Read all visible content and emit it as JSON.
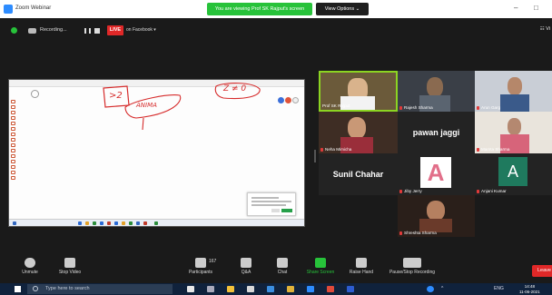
{
  "window": {
    "title": "Zoom Webinar",
    "viewing_banner": "You are viewing Prof SK Rajput's screen",
    "view_options": "View Options ⌄",
    "controls": [
      "–",
      "□"
    ]
  },
  "status": {
    "recording_label": "Recording...",
    "live_badge": "LIVE",
    "live_on": "on Facebook ▾",
    "view_button": "☷ Vi"
  },
  "share": {
    "annotation_1": ">2",
    "annotation_2": "ANIMA",
    "annotation_3": "Z ≠ 0"
  },
  "participants": [
    {
      "name": "Prof SK Rajput",
      "active": true
    },
    {
      "name": "Rajesh Sharma"
    },
    {
      "name": "Arun Garg"
    },
    {
      "name": "Neha Mimicha"
    },
    {
      "name": "pawan jaggi",
      "display_text": "pawan jaggi"
    },
    {
      "name": "Mamta Sharma"
    },
    {
      "name": "Sunil Chahar",
      "display_text": "Sunil Chahar"
    },
    {
      "name": "Jiby Jerry",
      "display_text": "A"
    },
    {
      "name": "Anjani Kumar",
      "display_text": "A"
    },
    {
      "name": "Shreshta Sharma"
    }
  ],
  "toolbar": {
    "unmute": "Unmute",
    "stop_video": "Stop Video",
    "participants": "Participants",
    "participants_count": "167",
    "qa": "Q&A",
    "chat": "Chat",
    "share_screen": "Share Screen",
    "raise_hand": "Raise Hand",
    "recording": "Pause/Stop Recording",
    "leave": "Leave"
  },
  "taskbar": {
    "search_placeholder": "Type here to search",
    "lang": "ENG",
    "time": "14:48",
    "date": "11-06-2021"
  },
  "colors": {
    "accent_green": "#27c23a",
    "live_red": "#e02828",
    "annotation_red": "#d62b2b",
    "speaker_border": "#8cd422"
  }
}
